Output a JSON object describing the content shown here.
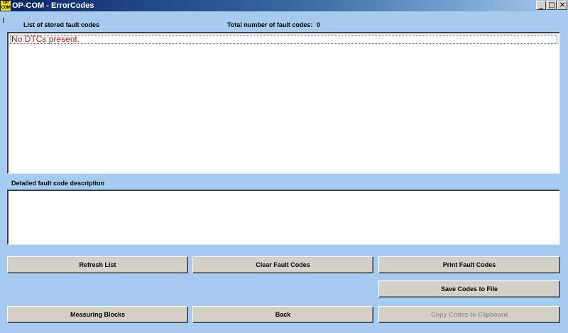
{
  "window": {
    "icon_text_top": "OP",
    "icon_text_bottom": "COM",
    "title": "OP-COM - ErrorCodes",
    "minimize_glyph": "_",
    "maximize_glyph": "□",
    "close_glyph": "✕"
  },
  "fault_list": {
    "label": "List of stored fault codes",
    "total_label": "Total number of fault codes:",
    "total_value": "0",
    "entries": [
      "No DTCs present."
    ],
    "entry_color": "#b22222"
  },
  "description": {
    "label": "Detailed fault code description",
    "text": ""
  },
  "buttons": {
    "refresh": "Refresh List",
    "clear": "Clear Fault Codes",
    "print": "Print Fault Codes",
    "save": "Save Codes to File",
    "measuring": "Measuring Blocks",
    "back": "Back",
    "copy": "Copy Codes to Clipboard"
  },
  "colors": {
    "background": "#a6caf0",
    "button_face": "#d4d0c8",
    "disabled_text": "#9a9a9a"
  }
}
